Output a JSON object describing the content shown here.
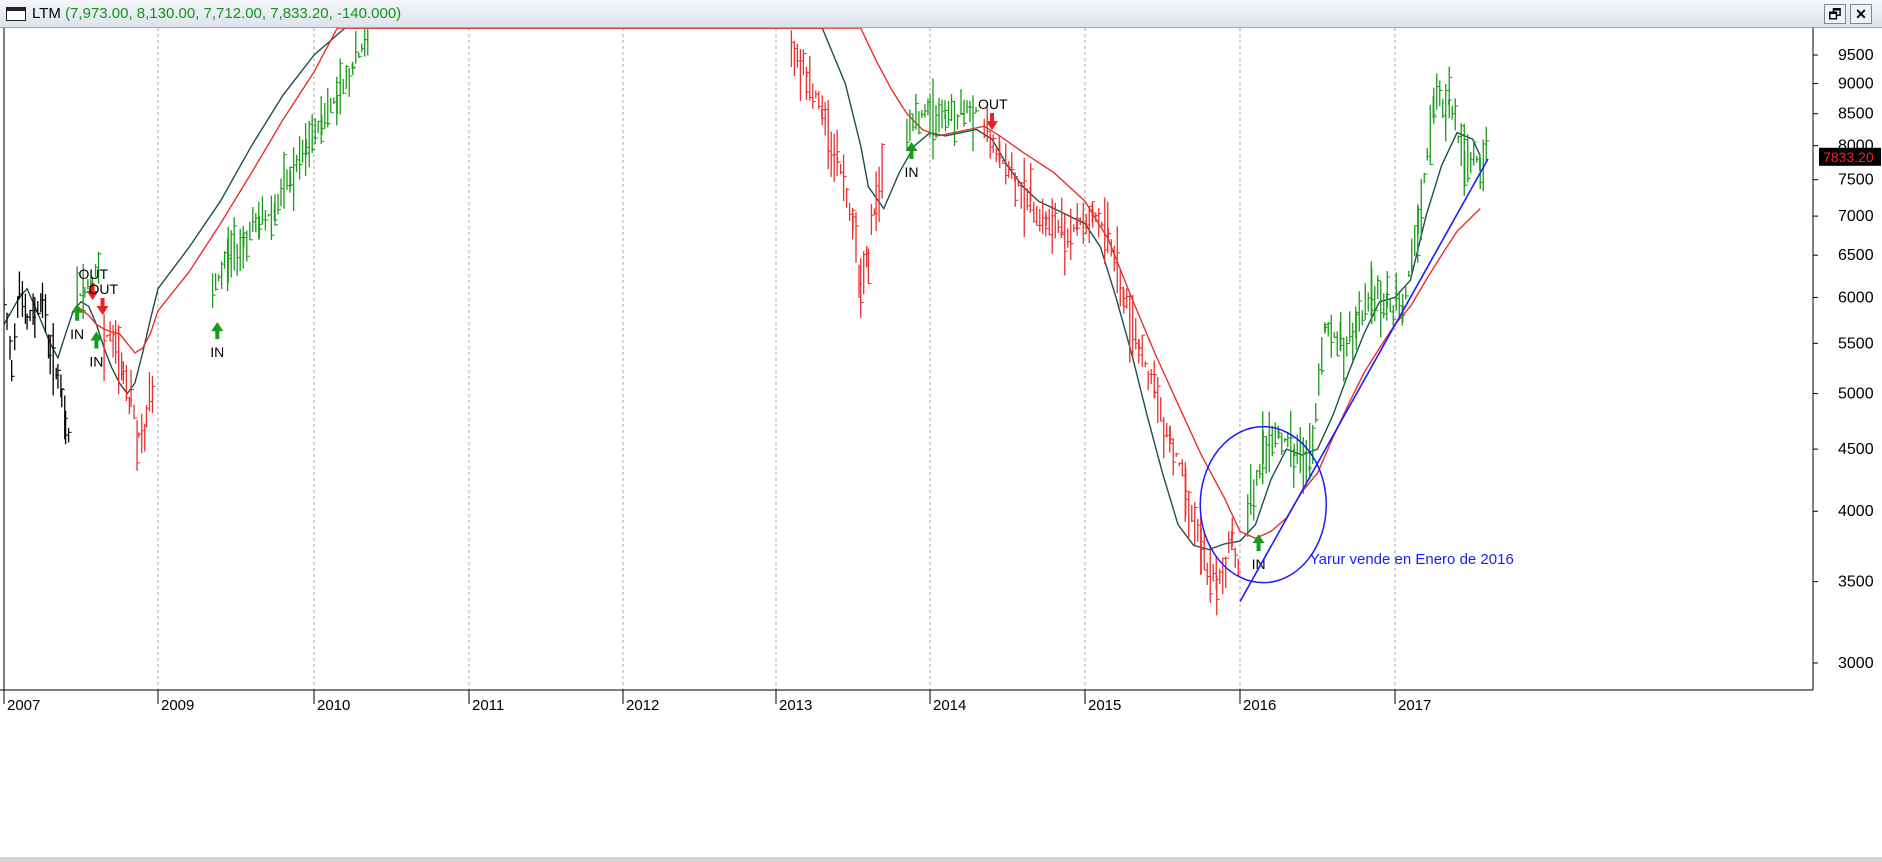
{
  "window": {
    "title": "LTM",
    "values": "(7,973.00, 8,130.00, 7,712.00, 7,833.20, -140.000)",
    "restore_glyph": "🗗",
    "close_glyph": "✕"
  },
  "chart_data": {
    "type": "bar",
    "subtype": "OHLC weekly price bars with two moving averages, log scale",
    "title": "LTM",
    "ohlc_last": {
      "open": 7973.0,
      "high": 8130.0,
      "low": 7712.0,
      "close": 7833.2,
      "change": -140.0
    },
    "last_price_label": "7833.20",
    "y_scale": "log",
    "ylim": [
      2850,
      10000
    ],
    "y_ticks": [
      3000,
      3500,
      4000,
      4500,
      5000,
      5500,
      6000,
      6500,
      7000,
      7500,
      8000,
      8500,
      9000,
      9500
    ],
    "y_tick_labels": [
      "3000",
      "3500",
      "4000",
      "4500",
      "5000",
      "5500",
      "6000",
      "6500",
      "7000",
      "7500",
      "8000",
      "8500",
      "9000",
      "9500"
    ],
    "x_range": [
      2007.0,
      2017.75
    ],
    "x_ticks": [
      "2007",
      "2009",
      "2010",
      "2011",
      "2012",
      "2013",
      "2014",
      "2015",
      "2016",
      "2017"
    ],
    "grid": {
      "vertical": true,
      "horizontal": false
    },
    "series": [
      {
        "role": "price_black",
        "color": "#000000",
        "points": [
          [
            2007.0,
            5900
          ],
          [
            2007.1,
            5300
          ],
          [
            2007.2,
            6200
          ],
          [
            2007.3,
            5700
          ],
          [
            2007.4,
            5850
          ],
          [
            2007.5,
            6000
          ],
          [
            2007.6,
            5400
          ],
          [
            2007.7,
            5200
          ],
          [
            2007.75,
            4900
          ],
          [
            2007.8,
            4700
          ],
          [
            2007.85,
            4650
          ]
        ]
      },
      {
        "role": "price_green",
        "color": "#1a9a1a",
        "points": [
          [
            2007.95,
            6000
          ],
          [
            2008.05,
            6100
          ],
          [
            2008.15,
            6200
          ],
          [
            2008.25,
            6300
          ],
          [
            2009.35,
            6000
          ],
          [
            2009.45,
            6500
          ],
          [
            2009.55,
            6700
          ],
          [
            2009.65,
            6900
          ],
          [
            2009.75,
            7100
          ],
          [
            2009.85,
            7500
          ],
          [
            2009.95,
            7900
          ],
          [
            2010.05,
            8400
          ],
          [
            2010.15,
            8800
          ],
          [
            2010.25,
            9300
          ],
          [
            2010.35,
            9800
          ],
          [
            2013.85,
            8300
          ],
          [
            2014.0,
            8500
          ],
          [
            2014.1,
            8450
          ],
          [
            2014.2,
            8500
          ],
          [
            2014.3,
            8600
          ],
          [
            2016.05,
            3950
          ],
          [
            2016.15,
            4500
          ],
          [
            2016.25,
            4650
          ],
          [
            2016.35,
            4450
          ],
          [
            2016.45,
            4350
          ],
          [
            2016.55,
            5700
          ],
          [
            2016.65,
            5500
          ],
          [
            2016.75,
            5600
          ],
          [
            2016.85,
            6100
          ],
          [
            2016.95,
            5900
          ],
          [
            2017.05,
            5900
          ],
          [
            2017.15,
            6800
          ],
          [
            2017.25,
            8600
          ],
          [
            2017.35,
            8700
          ],
          [
            2017.45,
            7750
          ],
          [
            2017.55,
            7800
          ],
          [
            2017.6,
            7900
          ]
        ]
      },
      {
        "role": "price_red",
        "color": "#e83030",
        "points": [
          [
            2008.3,
            5600
          ],
          [
            2008.45,
            5500
          ],
          [
            2008.55,
            5200
          ],
          [
            2008.65,
            4900
          ],
          [
            2008.75,
            4600
          ],
          [
            2008.85,
            4700
          ],
          [
            2008.95,
            5200
          ],
          [
            2013.1,
            9800
          ],
          [
            2013.2,
            9200
          ],
          [
            2013.3,
            8500
          ],
          [
            2013.4,
            7800
          ],
          [
            2013.5,
            7000
          ],
          [
            2013.55,
            6200
          ],
          [
            2013.6,
            6500
          ],
          [
            2013.65,
            7200
          ],
          [
            2013.7,
            7700
          ],
          [
            2014.35,
            8200
          ],
          [
            2014.45,
            7800
          ],
          [
            2014.55,
            7500
          ],
          [
            2014.65,
            7200
          ],
          [
            2014.75,
            6900
          ],
          [
            2014.85,
            6800
          ],
          [
            2014.95,
            6900
          ],
          [
            2015.05,
            7000
          ],
          [
            2015.15,
            6800
          ],
          [
            2015.25,
            6000
          ],
          [
            2015.35,
            5500
          ],
          [
            2015.45,
            5000
          ],
          [
            2015.55,
            4600
          ],
          [
            2015.65,
            4200
          ],
          [
            2015.75,
            3700
          ],
          [
            2015.85,
            3450
          ],
          [
            2015.95,
            3800
          ],
          [
            2016.0,
            3600
          ]
        ]
      },
      {
        "role": "ma_fast",
        "color": "#1f4f4f",
        "points": [
          [
            2007.0,
            5700
          ],
          [
            2007.2,
            6000
          ],
          [
            2007.3,
            6100
          ],
          [
            2007.45,
            5800
          ],
          [
            2007.6,
            5500
          ],
          [
            2007.7,
            5350
          ],
          [
            2007.8,
            5600
          ],
          [
            2007.9,
            5850
          ],
          [
            2008.0,
            5950
          ],
          [
            2008.1,
            5900
          ],
          [
            2008.2,
            5700
          ],
          [
            2008.3,
            5450
          ],
          [
            2008.4,
            5250
          ],
          [
            2008.5,
            5100
          ],
          [
            2008.6,
            5000
          ],
          [
            2008.7,
            5100
          ],
          [
            2008.8,
            5400
          ],
          [
            2008.9,
            5750
          ],
          [
            2009.0,
            6100
          ],
          [
            2009.2,
            6600
          ],
          [
            2009.4,
            7200
          ],
          [
            2009.6,
            8000
          ],
          [
            2009.8,
            8800
          ],
          [
            2010.0,
            9500
          ],
          [
            2010.2,
            10000
          ],
          [
            2013.3,
            10000
          ],
          [
            2013.45,
            9000
          ],
          [
            2013.55,
            8000
          ],
          [
            2013.6,
            7400
          ],
          [
            2013.7,
            7100
          ],
          [
            2013.8,
            7600
          ],
          [
            2013.9,
            8000
          ],
          [
            2014.0,
            8200
          ],
          [
            2014.1,
            8150
          ],
          [
            2014.2,
            8200
          ],
          [
            2014.3,
            8250
          ],
          [
            2014.4,
            8100
          ],
          [
            2014.5,
            7700
          ],
          [
            2014.6,
            7400
          ],
          [
            2014.7,
            7200
          ],
          [
            2014.8,
            7100
          ],
          [
            2014.9,
            7000
          ],
          [
            2015.0,
            6900
          ],
          [
            2015.1,
            6600
          ],
          [
            2015.2,
            6000
          ],
          [
            2015.3,
            5400
          ],
          [
            2015.4,
            4800
          ],
          [
            2015.5,
            4300
          ],
          [
            2015.6,
            3900
          ],
          [
            2015.7,
            3750
          ],
          [
            2015.8,
            3720
          ],
          [
            2015.9,
            3760
          ],
          [
            2016.0,
            3780
          ],
          [
            2016.1,
            3900
          ],
          [
            2016.2,
            4250
          ],
          [
            2016.3,
            4500
          ],
          [
            2016.4,
            4450
          ],
          [
            2016.5,
            4500
          ],
          [
            2016.6,
            4800
          ],
          [
            2016.7,
            5200
          ],
          [
            2016.8,
            5600
          ],
          [
            2016.9,
            5950
          ],
          [
            2017.0,
            6000
          ],
          [
            2017.1,
            6200
          ],
          [
            2017.2,
            7000
          ],
          [
            2017.3,
            7700
          ],
          [
            2017.4,
            8200
          ],
          [
            2017.5,
            8100
          ],
          [
            2017.55,
            7850
          ]
        ]
      },
      {
        "role": "ma_slow",
        "color": "#e83030",
        "points": [
          [
            2007.95,
            5900
          ],
          [
            2008.1,
            5800
          ],
          [
            2008.2,
            5700
          ],
          [
            2008.3,
            5650
          ],
          [
            2008.4,
            5620
          ],
          [
            2008.5,
            5600
          ],
          [
            2008.6,
            5500
          ],
          [
            2008.7,
            5400
          ],
          [
            2008.8,
            5450
          ],
          [
            2008.9,
            5600
          ],
          [
            2009.0,
            5850
          ],
          [
            2009.2,
            6300
          ],
          [
            2009.4,
            6900
          ],
          [
            2009.6,
            7600
          ],
          [
            2009.8,
            8400
          ],
          [
            2010.0,
            9200
          ],
          [
            2010.15,
            10000
          ],
          [
            2013.55,
            10000
          ],
          [
            2013.65,
            9400
          ],
          [
            2013.75,
            8900
          ],
          [
            2013.85,
            8500
          ],
          [
            2013.95,
            8250
          ],
          [
            2014.05,
            8150
          ],
          [
            2014.15,
            8200
          ],
          [
            2014.25,
            8250
          ],
          [
            2014.35,
            8300
          ],
          [
            2014.45,
            8150
          ],
          [
            2014.6,
            7900
          ],
          [
            2014.8,
            7600
          ],
          [
            2015.0,
            7200
          ],
          [
            2015.15,
            6700
          ],
          [
            2015.3,
            6000
          ],
          [
            2015.45,
            5400
          ],
          [
            2015.6,
            4900
          ],
          [
            2015.75,
            4450
          ],
          [
            2015.9,
            4100
          ],
          [
            2016.0,
            3850
          ],
          [
            2016.1,
            3800
          ],
          [
            2016.2,
            3850
          ],
          [
            2016.3,
            3950
          ],
          [
            2016.4,
            4150
          ],
          [
            2016.5,
            4300
          ],
          [
            2016.6,
            4600
          ],
          [
            2016.7,
            4900
          ],
          [
            2016.8,
            5200
          ],
          [
            2016.9,
            5450
          ],
          [
            2017.0,
            5700
          ],
          [
            2017.1,
            5900
          ],
          [
            2017.2,
            6200
          ],
          [
            2017.3,
            6500
          ],
          [
            2017.4,
            6800
          ],
          [
            2017.5,
            7000
          ],
          [
            2017.55,
            7100
          ]
        ]
      }
    ],
    "signals": [
      {
        "type": "IN",
        "label": "IN",
        "x": 2007.95,
        "y": 5850
      },
      {
        "type": "OUT",
        "label": "OUT",
        "x": 2008.15,
        "y": 6050
      },
      {
        "type": "OUT",
        "label": "OUT",
        "x": 2008.28,
        "y": 5880
      },
      {
        "type": "IN",
        "label": "IN",
        "x": 2008.2,
        "y": 5550
      },
      {
        "type": "IN",
        "label": "IN",
        "x": 2009.38,
        "y": 5650
      },
      {
        "type": "IN",
        "label": "IN",
        "x": 2013.88,
        "y": 7950
      },
      {
        "type": "OUT",
        "label": "OUT",
        "x": 2014.4,
        "y": 8350
      },
      {
        "type": "IN",
        "label": "IN",
        "x": 2016.12,
        "y": 3780
      }
    ],
    "trendline": {
      "color": "#1c1cff",
      "from": [
        2016.0,
        3370
      ],
      "to": [
        2017.6,
        7800
      ]
    },
    "circle": {
      "color": "#1c1cff",
      "center": [
        2016.15,
        4050
      ]
    },
    "annotation": {
      "text": "Yarur vende en Enero de 2016",
      "color": "#1c1cff",
      "x": 2016.45,
      "y": 3620
    }
  }
}
